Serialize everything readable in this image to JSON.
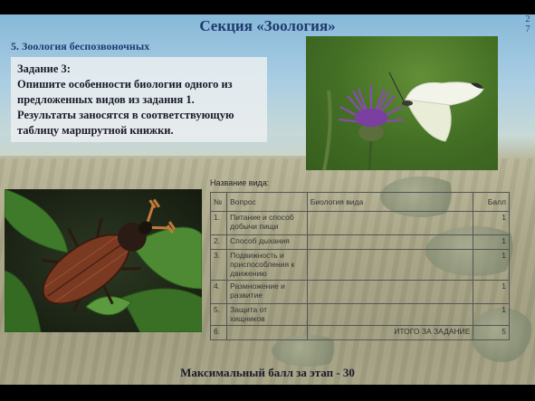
{
  "header": {
    "title": "Секция «Зоология»",
    "page_number_lines": [
      "2",
      "7"
    ],
    "subtitle": "5. Зоология беспозвоночных"
  },
  "task": {
    "lines": [
      "Задание 3:",
      "Опишите особенности биологии одного из",
      "предложенных видов из задания 1.",
      "Результаты заносятся в соответствующую",
      "таблицу маршрутной книжки."
    ]
  },
  "table": {
    "caption": "Название вида:",
    "columns": [
      "№",
      "Вопрос",
      "Биология вида",
      "Балл"
    ],
    "rows": [
      {
        "num": "1.",
        "question": "Питание и способ добычи пищи",
        "biology": "",
        "score": "1"
      },
      {
        "num": "2.",
        "question": "Способ дыхания",
        "biology": "",
        "score": "1"
      },
      {
        "num": "3.",
        "question": "Подвижность и приспособления к движению",
        "biology": "",
        "score": "1"
      },
      {
        "num": "4.",
        "question": "Размножение и развитие",
        "biology": "",
        "score": "1"
      },
      {
        "num": "5.",
        "question": "Защита от хищников",
        "biology": "",
        "score": "1"
      },
      {
        "num": "6.",
        "question": "",
        "biology": "ИТОГО ЗА ЗАДАНИЕ",
        "score": "5"
      }
    ]
  },
  "footer": {
    "text": "Максимальный балл за этап - 30"
  },
  "colors": {
    "heading": "#1f3a6e",
    "sky": "#7fb4d6",
    "steppe": "#a8a487"
  },
  "images": [
    "butterfly-on-thistle-photo",
    "cockchafer-beetle-photo"
  ]
}
